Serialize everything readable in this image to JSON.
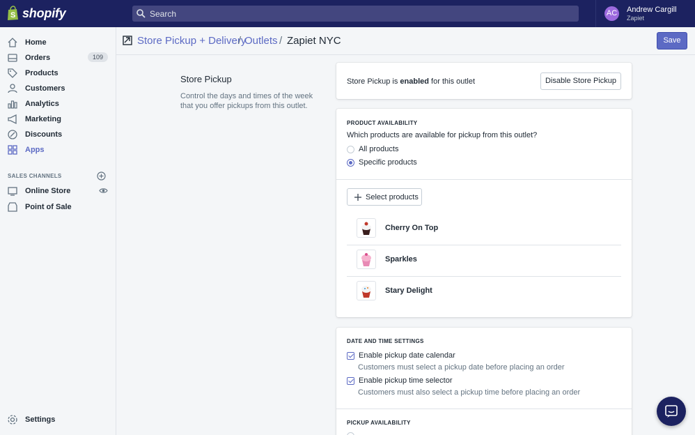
{
  "topbar": {
    "brand": "shopify",
    "search_placeholder": "Search",
    "user": {
      "initials": "AC",
      "name": "Andrew Cargill",
      "company": "Zapiet"
    }
  },
  "sidebar": {
    "items": [
      {
        "label": "Home",
        "icon": "home-icon"
      },
      {
        "label": "Orders",
        "icon": "orders-icon",
        "badge": "109"
      },
      {
        "label": "Products",
        "icon": "tag-icon"
      },
      {
        "label": "Customers",
        "icon": "customers-icon"
      },
      {
        "label": "Analytics",
        "icon": "bar-chart-icon"
      },
      {
        "label": "Marketing",
        "icon": "megaphone-icon"
      },
      {
        "label": "Discounts",
        "icon": "discount-icon"
      },
      {
        "label": "Apps",
        "icon": "apps-icon"
      }
    ],
    "sales_channels_heading": "SALES CHANNELS",
    "channels": [
      {
        "label": "Online Store",
        "icon": "store-icon"
      },
      {
        "label": "Point of Sale",
        "icon": "pos-icon"
      }
    ],
    "settings_label": "Settings"
  },
  "header": {
    "crumb_1": "Store Pickup + Delivery",
    "crumb_2": "Outlets",
    "separator": "/",
    "current": "Zapiet NYC",
    "save_label": "Save"
  },
  "annotation": {
    "title": "Store Pickup",
    "description": "Control the days and times of the week that you offer pickups from this outlet."
  },
  "status_card": {
    "text_before": "Store Pickup is ",
    "status": "enabled",
    "text_after": " for this outlet",
    "button": "Disable Store Pickup"
  },
  "product_availability": {
    "heading": "PRODUCT AVAILABILITY",
    "question": "Which products are available for pickup from this outlet?",
    "options": [
      "All products",
      "Specific products"
    ],
    "selected": "Specific products",
    "select_button": "Select products",
    "products": [
      "Cherry On Top",
      "Sparkles",
      "Stary Delight"
    ]
  },
  "date_time": {
    "heading": "DATE AND TIME SETTINGS",
    "calendar_label": "Enable pickup date calendar",
    "calendar_help": "Customers must select a pickup date before placing an order",
    "time_label": "Enable pickup time selector",
    "time_help": "Customers must also select a pickup time before placing an order"
  },
  "pickup_availability": {
    "heading": "PICKUP AVAILABILITY"
  },
  "colors": {
    "topbar": "#1c2260",
    "accent": "#5c6ac4",
    "avatar": "#9c6ade"
  }
}
